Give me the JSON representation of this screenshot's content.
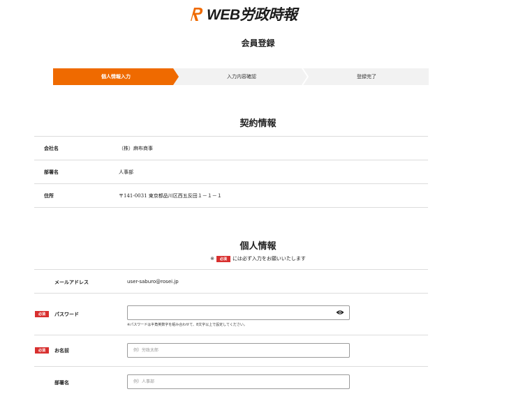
{
  "header": {
    "logo_text": "WEB労政時報",
    "brand_color": "#ef6a00"
  },
  "page": {
    "title": "会員登録"
  },
  "steps": [
    {
      "label": "個人情報入力",
      "active": true
    },
    {
      "label": "入力内容確認",
      "active": false
    },
    {
      "label": "登録完了",
      "active": false
    }
  ],
  "contract": {
    "title": "契約情報",
    "rows": [
      {
        "label": "会社名",
        "value": "（株）麻布商事"
      },
      {
        "label": "部署名",
        "value": "人事部"
      },
      {
        "label": "住所",
        "value": "〒141-0031 東京都品川区西五反田１－１－１"
      }
    ]
  },
  "personal": {
    "title": "個人情報",
    "note_prefix": "※",
    "note_badge": "必須",
    "note_suffix": "には必ず入力をお願いいたします",
    "email_label": "メールアドレス",
    "email_value": "user-saburo@rosei.jp",
    "required_badge": "必須",
    "password_label": "パスワード",
    "password_value": "",
    "password_help": "※パスワードは半角英数字を組み合わせて、8文字以上で設定してください。",
    "name_label": "お名前",
    "name_placeholder": "例）労政太郎",
    "dept_label": "部署名",
    "dept_placeholder": "例）人事部"
  },
  "colors": {
    "accent": "#ef6a00",
    "required": "#d8302f"
  }
}
